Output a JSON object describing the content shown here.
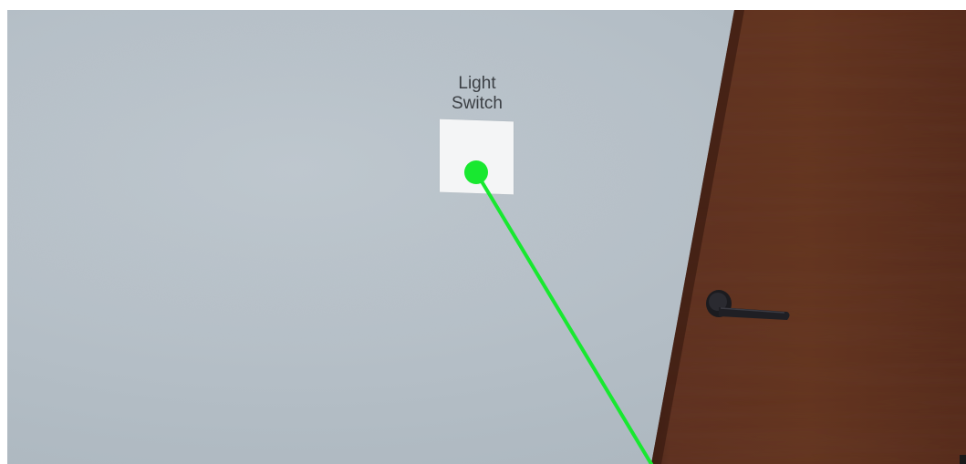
{
  "scene": {
    "wall_color": "#b6c0c8",
    "door_color": "#5c2f1f",
    "handle_color": "#1e1e22",
    "pointer_color": "#18e830"
  },
  "light_switch": {
    "label": "Light\nSwitch",
    "plate_color": "#f4f5f6"
  }
}
